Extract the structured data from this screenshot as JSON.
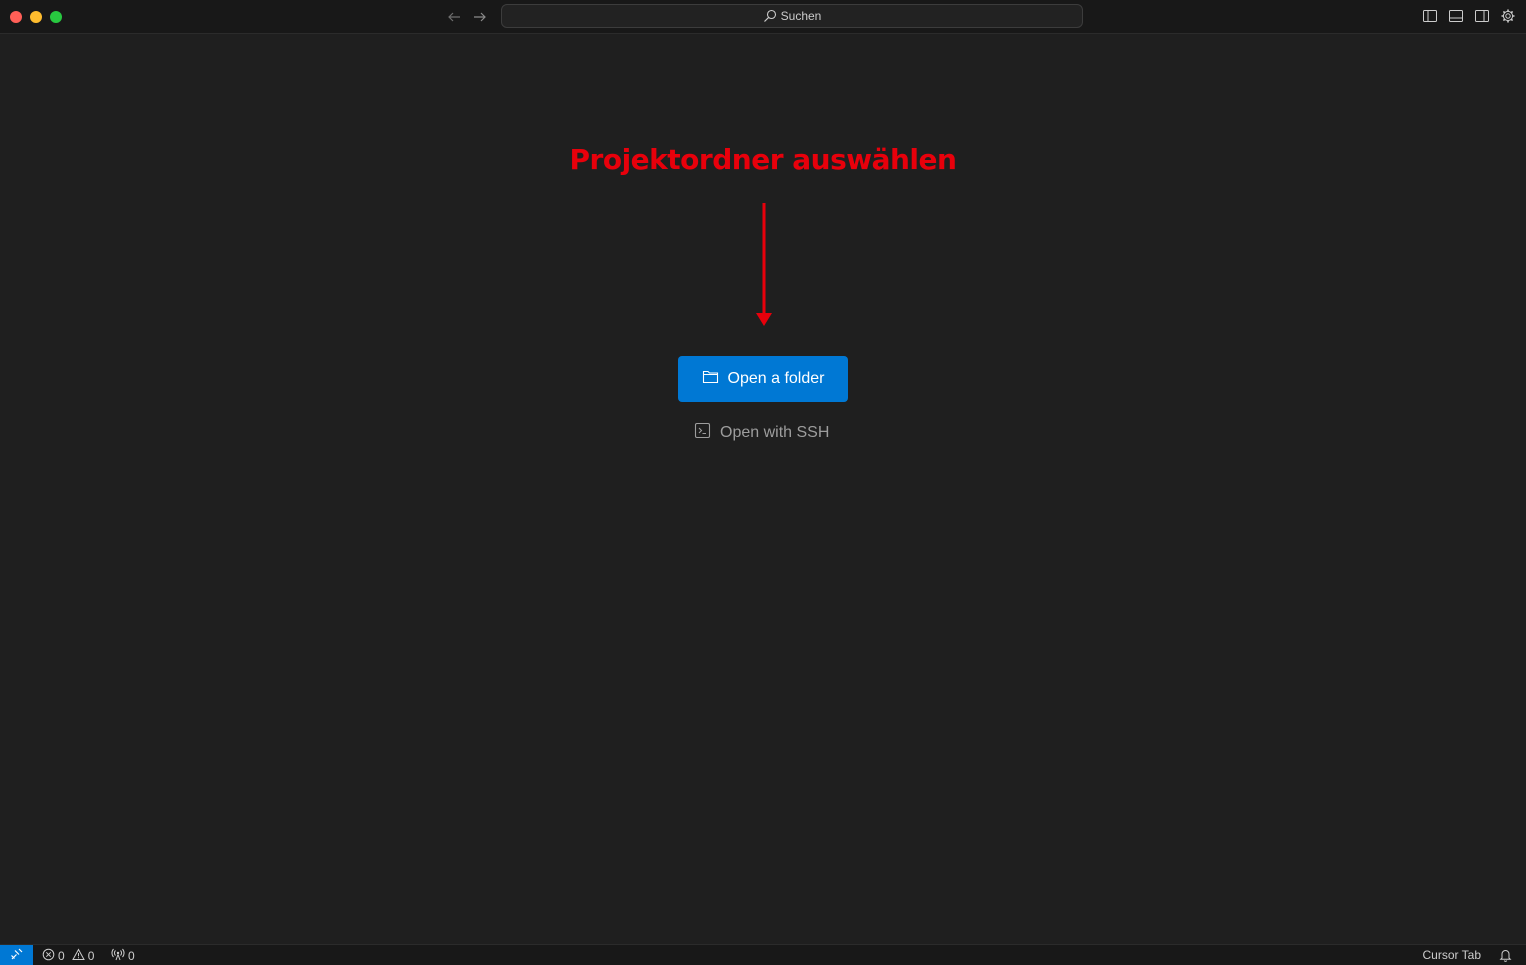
{
  "titlebar": {
    "search_label": "Suchen"
  },
  "annotation": {
    "text": "Projektordner auswählen",
    "color": "#e8000b"
  },
  "welcome": {
    "open_folder_label": "Open a folder",
    "open_ssh_label": "Open with SSH"
  },
  "statusbar": {
    "errors": "0",
    "warnings": "0",
    "ports": "0",
    "cursor_tab": "Cursor Tab"
  },
  "colors": {
    "background": "#1f1f1f",
    "titlebar": "#181818",
    "accent": "#0078d4"
  },
  "icons": [
    "back-arrow-icon",
    "forward-arrow-icon",
    "search-icon",
    "toggle-primary-sidebar-icon",
    "toggle-panel-icon",
    "toggle-secondary-sidebar-icon",
    "gear-icon",
    "folder-icon",
    "terminal-icon",
    "remote-icon",
    "error-icon",
    "warning-icon",
    "broadcast-icon",
    "bell-icon"
  ]
}
